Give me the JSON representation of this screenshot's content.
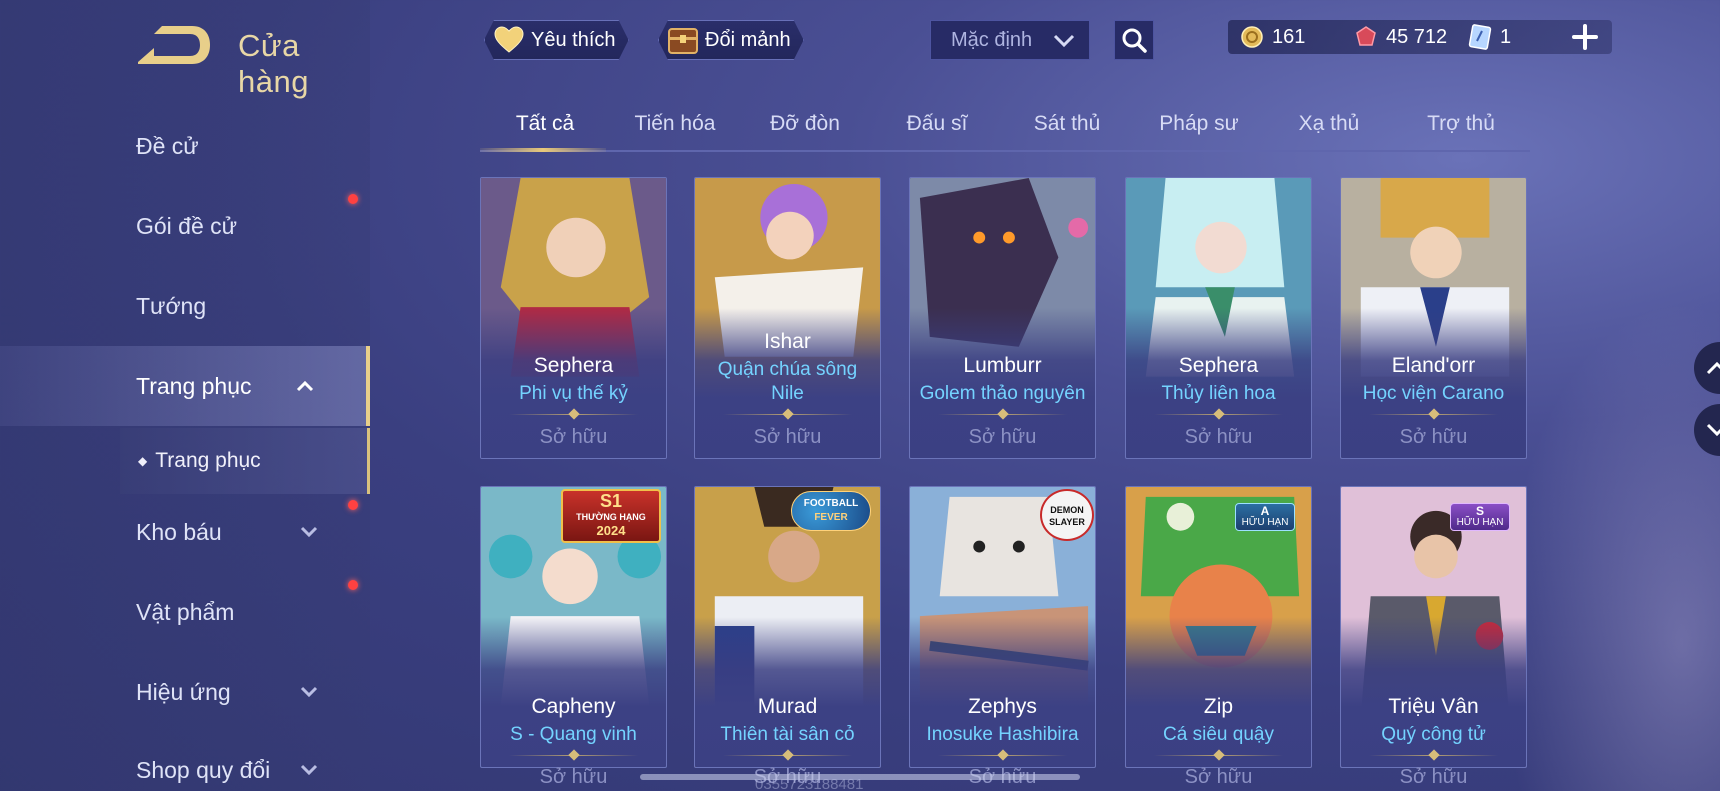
{
  "sidebar": {
    "title": "Cửa hàng",
    "items": [
      {
        "label": "Đề cử"
      },
      {
        "label": "Gói đề cử"
      },
      {
        "label": "Tướng"
      },
      {
        "label": "Trang phục"
      },
      {
        "label": "Kho báu"
      },
      {
        "label": "Vật phẩm"
      },
      {
        "label": "Hiệu ứng"
      },
      {
        "label": "Shop quy đổi"
      }
    ],
    "sub_item": "Trang phục"
  },
  "topbar": {
    "favorites_label": "Yêu thích",
    "exchange_label": "Đổi mảnh",
    "sort_value": "Mặc định",
    "currencies": {
      "gold": "161",
      "ruby": "45 712",
      "voucher": "1"
    }
  },
  "tabs": [
    {
      "label": "Tất cả"
    },
    {
      "label": "Tiến hóa"
    },
    {
      "label": "Đỡ đòn"
    },
    {
      "label": "Đấu sĩ"
    },
    {
      "label": "Sát thủ"
    },
    {
      "label": "Pháp sư"
    },
    {
      "label": "Xạ thủ"
    },
    {
      "label": "Trợ thủ"
    }
  ],
  "cards": [
    {
      "hero": "Sephera",
      "skin": "Phi vụ thế kỷ",
      "status": "Sở hữu"
    },
    {
      "hero": "Ishar",
      "skin": "Quận chúa sông Nile",
      "status": "Sở hữu"
    },
    {
      "hero": "Lumburr",
      "skin": "Golem thảo nguyên",
      "status": "Sở hữu"
    },
    {
      "hero": "Sephera",
      "skin": "Thủy liên hoa",
      "status": "Sở hữu"
    },
    {
      "hero": "Eland'orr",
      "skin": "Học viện Carano",
      "status": "Sở hữu"
    },
    {
      "hero": "Capheny",
      "skin": "S - Quang vinh",
      "status": "Sở hữu",
      "tag_line1": "S1",
      "tag_line2": "THƯỜNG HẠNG",
      "tag_line3": "2024"
    },
    {
      "hero": "Murad",
      "skin": "Thiên tài sân cỏ",
      "status": "Sở hữu",
      "tag_line1": "FOOTBALL",
      "tag_line2": "FEVER"
    },
    {
      "hero": "Zephys",
      "skin": "Inosuke Hashibira",
      "status": "Sở hữu",
      "tag_line1": "DEMON",
      "tag_line2": "SLAYER"
    },
    {
      "hero": "Zip",
      "skin": "Cá siêu quậy",
      "status": "Sở hữu",
      "tag_line1": "A",
      "tag_line2": "HỮU HẠN"
    },
    {
      "hero": "Triệu Vân",
      "skin": "Quý công tử",
      "status": "Sở hữu",
      "tag_line1": "S",
      "tag_line2": "HỮU HẠN"
    }
  ],
  "watermark": "0355723188481"
}
